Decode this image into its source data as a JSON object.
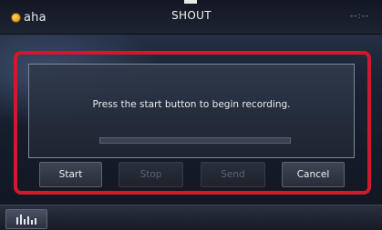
{
  "header": {
    "logo_text": "aha",
    "title": "SHOUT",
    "clock": "--:--"
  },
  "dialog": {
    "message": "Press the start button to begin recording.",
    "progress": 0
  },
  "buttons": {
    "start": "Start",
    "stop": "Stop",
    "send": "Send",
    "cancel": "Cancel"
  },
  "bottom_bar": {
    "eq_icon": "equalizer-icon"
  },
  "colors": {
    "highlight_frame": "#d4182c",
    "logo_accent": "#f0a21a"
  }
}
